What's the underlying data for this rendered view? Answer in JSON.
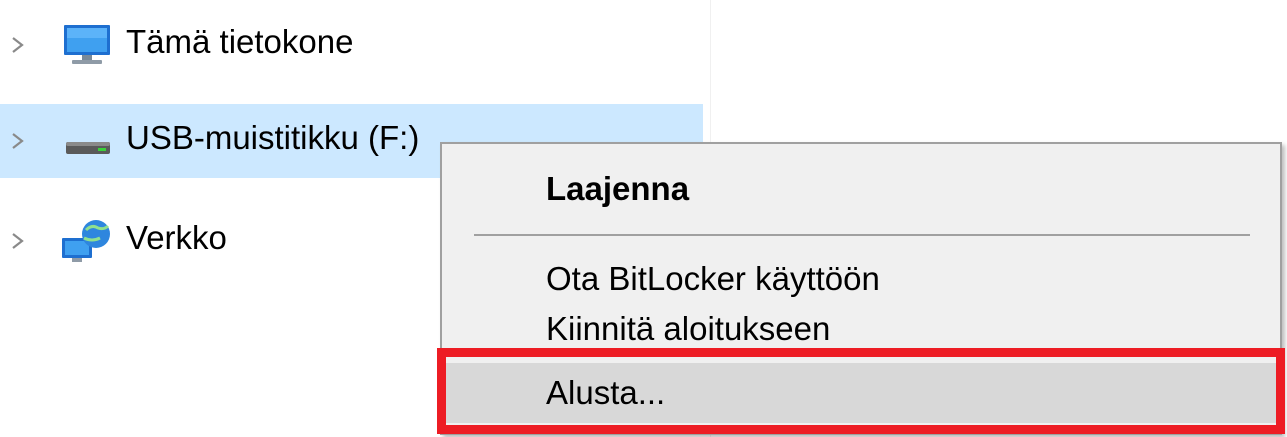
{
  "tree": {
    "items": [
      {
        "label": "Tämä tietokone",
        "icon": "computer-icon",
        "selected": false
      },
      {
        "label": "USB-muistitikku (F:)",
        "icon": "usb-drive-icon",
        "selected": true
      },
      {
        "label": "Verkko",
        "icon": "network-icon",
        "selected": false
      }
    ]
  },
  "context_menu": {
    "items": [
      {
        "label": "Laajenna",
        "bold": true
      },
      {
        "label": "Ota BitLocker käyttöön"
      },
      {
        "label": "Kiinnitä aloitukseen"
      },
      {
        "label": "Alusta...",
        "highlighted": true
      }
    ]
  },
  "colors": {
    "selection": "#cce8ff",
    "menu_background": "#f0f0f0",
    "menu_hover": "#d8d8d8",
    "annotation_red": "#ed1c24"
  }
}
